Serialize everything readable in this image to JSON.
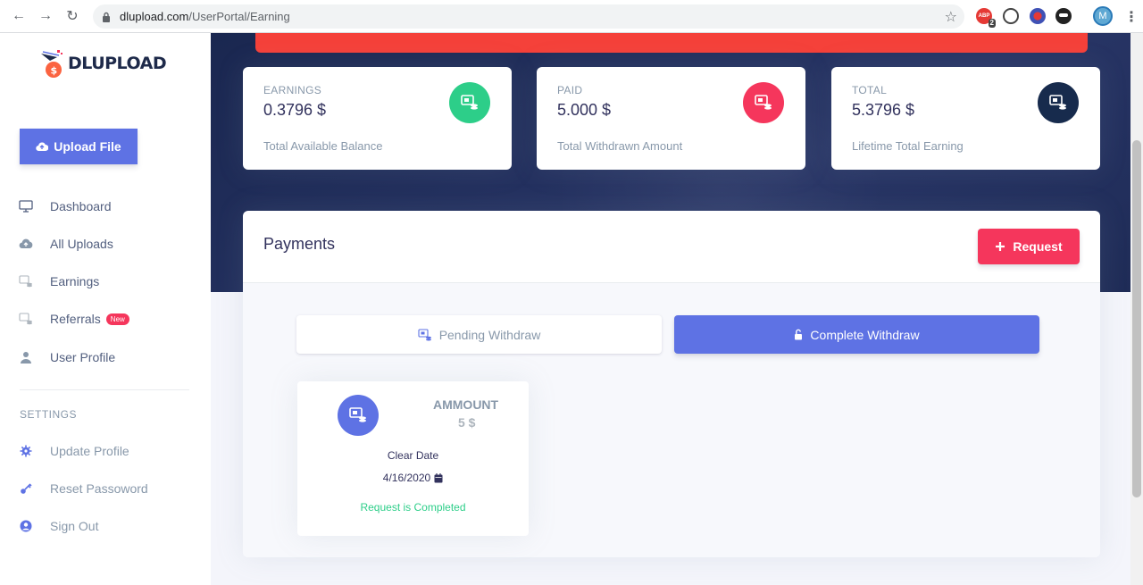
{
  "browser": {
    "url_domain": "dlupload.com",
    "url_path": "/UserPortal/Earning",
    "abp_label": "ABP",
    "abp_badge": "2",
    "profile_initial": "M"
  },
  "sidebar": {
    "logo_text": "DLUPLOAD",
    "upload_label": "Upload File",
    "items": [
      {
        "label": "Dashboard",
        "icon": "monitor-icon"
      },
      {
        "label": "All Uploads",
        "icon": "cloud-upload-icon"
      },
      {
        "label": "Earnings",
        "icon": "money-icon"
      },
      {
        "label": "Referrals",
        "icon": "money-icon",
        "badge": "New"
      },
      {
        "label": "User Profile",
        "icon": "user-icon"
      }
    ],
    "settings_heading": "SETTINGS",
    "settings_items": [
      {
        "label": "Update Profile",
        "icon": "gear-icon"
      },
      {
        "label": "Reset Passoword",
        "icon": "key-icon"
      },
      {
        "label": "Sign Out",
        "icon": "user-circle-icon"
      }
    ]
  },
  "stats": [
    {
      "title": "EARNINGS",
      "value": "0.3796 $",
      "desc": "Total Available Balance",
      "color": "#2dce89"
    },
    {
      "title": "PAID",
      "value": "5.000 $",
      "desc": "Total Withdrawn Amount",
      "color": "#f5365c"
    },
    {
      "title": "TOTAL",
      "value": "5.3796 $",
      "desc": "Lifetime Total Earning",
      "color": "#172b4d"
    }
  ],
  "payments": {
    "title": "Payments",
    "request_label": "Request",
    "tabs": {
      "pending": "Pending Withdraw",
      "complete": "Complete Withdraw"
    },
    "withdraw_card": {
      "amount_label": "AMMOUNT",
      "amount_value": "5 $",
      "clear_label": "Clear Date",
      "date": "4/16/2020",
      "status": "Request is Completed"
    }
  },
  "colors": {
    "primary": "#5e72e4",
    "danger": "#f5365c",
    "success": "#2dce89",
    "alert": "#f5413a",
    "hero": "#1f2c57"
  }
}
